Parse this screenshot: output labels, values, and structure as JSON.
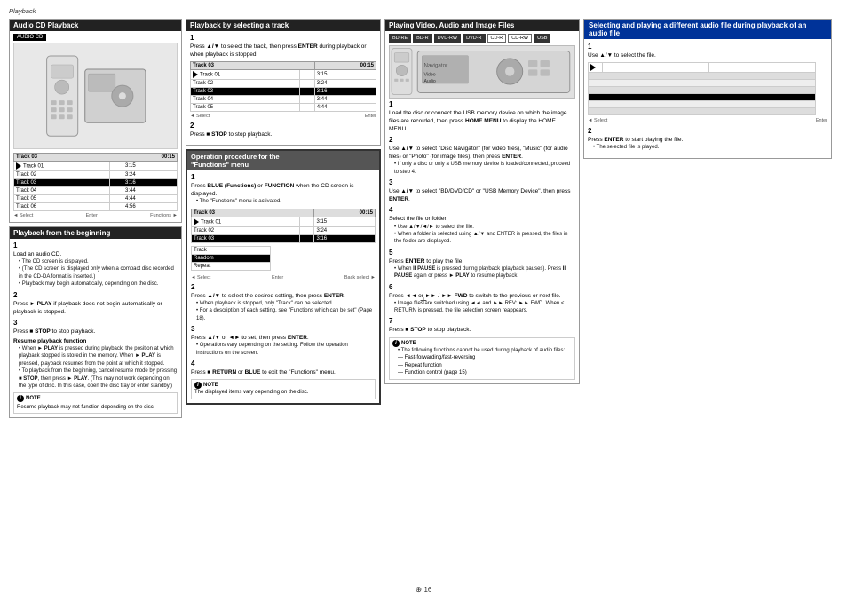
{
  "page": {
    "top_label": "Playback",
    "page_number": "16"
  },
  "section1": {
    "title": "Audio CD Playback",
    "badge": "AUDIO CD",
    "playback_from_beginning": {
      "title": "Playback from the beginning",
      "steps": [
        {
          "num": "1",
          "text": "Load an audio CD.",
          "bullets": [
            "The CD screen is displayed.",
            "(The CD screen is displayed only when a compact disc recorded in the CD-DA format is inserted.)",
            "Playback may begin automatically, depending on the disc."
          ]
        },
        {
          "num": "2",
          "text": "Press ► PLAY if playback does not begin automatically or playback is stopped."
        },
        {
          "num": "3",
          "text": "Press ■ STOP to stop playback."
        }
      ],
      "resume_title": "Resume playback function",
      "resume_bullets": [
        "When ► PLAY is pressed during playback, the position at which playback stopped is stored in the memory. When ► PLAY is pressed, playback resumes from the point at which it stopped.",
        "To playback from the beginning, cancel resume mode by pressing ■ STOP, then press ► PLAY. (This may not work depending on the type of disc. In this case, open the disc tray or enter standby.)"
      ],
      "note": "Resume playback may not function depending on the disc."
    },
    "track_table": {
      "headers": [
        "Track 03",
        "",
        "00:15"
      ],
      "tracks": [
        {
          "name": "Track 01",
          "time": "3:15",
          "selected": false
        },
        {
          "name": "Track 02",
          "time": "3:24",
          "selected": false
        },
        {
          "name": "Track 03",
          "time": "3:16",
          "selected": true
        },
        {
          "name": "Track 04",
          "time": "3:44",
          "selected": false
        },
        {
          "name": "Track 05",
          "time": "4:44",
          "selected": false
        },
        {
          "name": "Track 06",
          "time": "4:56",
          "selected": false
        }
      ],
      "footer": [
        "Select",
        "Enter",
        "Functions"
      ]
    }
  },
  "section2": {
    "title": "Playback by selecting a track",
    "step1": {
      "num": "1",
      "text": "Press ▲/▼ to select the track, then press ENTER during playback or when playback is stopped."
    },
    "step2": {
      "num": "2",
      "text": "Press ■ STOP to stop playback."
    },
    "op_section": {
      "title": "Operation procedure for the \"Functions\" menu",
      "step1": {
        "num": "1",
        "text": "Press BLUE (Functions) or FUNCTION when the CD screen is displayed.",
        "bullet": "The \"Functions\" menu is activated."
      },
      "step2": {
        "num": "2",
        "text": "Press ▲/▼ to select the desired setting, then press ENTER.",
        "bullet": "When playback is stopped, only \"Track\" can be selected.",
        "bullet2": "For a description of each setting, see \"Functions which can be set\" (Page 18)."
      },
      "step3": {
        "num": "3",
        "text": "Press ▲/▼ or ◄► to set, then press ENTER.",
        "bullet": "Operations vary depending on the setting. Follow the operation instructions on the screen."
      },
      "step4": {
        "num": "4",
        "text": "Press ■ RETURN or BLUE to exit the \"Functions\" menu."
      },
      "note": "The displayed items vary depending on the disc."
    },
    "track_table2": {
      "headers": [
        "Track 03",
        "",
        "00:15"
      ],
      "tracks": [
        {
          "name": "Track 01",
          "time": "3:15",
          "selected": false
        },
        {
          "name": "Track 02",
          "time": "3:24",
          "selected": false
        },
        {
          "name": "Track 03",
          "time": "3:16",
          "selected": true
        },
        {
          "name": "Track 04",
          "time": "3:44",
          "selected": false
        },
        {
          "name": "Track 05",
          "time": "4:44",
          "selected": false
        }
      ],
      "table2": {
        "col1": "Track",
        "col2_label": "Random",
        "rows": [
          {
            "item": "Track",
            "val": ""
          },
          {
            "item": "Random",
            "val": ""
          },
          {
            "item": "Repeat",
            "val": ""
          }
        ]
      },
      "footer": [
        "Select",
        "Enter",
        "Back select"
      ]
    }
  },
  "section3": {
    "title": "Playing Video, Audio and Image Files",
    "disc_badges": [
      "BD-RE",
      "BD-R",
      "DVD-RW",
      "DVD-R",
      "CD-R",
      "CD-RW",
      "USB"
    ],
    "steps": [
      {
        "num": "1",
        "text": "Load the disc or connect the USB memory device on which the image files are recorded, then press HOME MENU to display the HOME MENU."
      },
      {
        "num": "2",
        "text": "Use ▲/▼ to select \"Disc Navigator\" (for video files), \"Music\" (for audio files) or \"Photo\" (for image files), then press ENTER.",
        "bullet": "If only a disc or only a USB memory device is loaded/connected, proceed to step 4."
      },
      {
        "num": "3",
        "text": "Use ▲/▼ to select \"BD/DVD/CD\" or \"USB Memory Device\", then press ENTER."
      },
      {
        "num": "4",
        "text": "Select the file or folder.",
        "bullets": [
          "Use ▲/▼/◄/► to select the file.",
          "When a folder is selected using ▲/▼ and ENTER is pressed, the files in the folder are displayed."
        ]
      },
      {
        "num": "5",
        "text": "Press ENTER to play the file.",
        "bullets": [
          "When II PAUSE is pressed during playback (playback pauses). Press II PAUSE again or press ► PLAY to resume playback."
        ]
      },
      {
        "num": "6",
        "text": "Press ◄◄ or ►► / ►► / ►► to switch to the previous or next file.",
        "bullets": [
          "Image files are switched using ◄◄ and ►► REV: ►► FWD. When < RETURN is pressed, the file selection screen reappears."
        ]
      },
      {
        "num": "7",
        "text": "Press ■ STOP to stop playback."
      }
    ],
    "note": {
      "title": "NOTE",
      "bullets": [
        "The following functions cannot be used during playback of audio files:",
        "— Fast-forwarding/fast-reversing",
        "— Repeat function",
        "— Function control (page 15)"
      ]
    }
  },
  "section4": {
    "title": "Selecting and playing a different audio file during playback of an audio file",
    "steps": [
      {
        "num": "1",
        "text": "Use ▲/▼ to select the file."
      },
      {
        "num": "2",
        "text": "Press ENTER to start playing the file.",
        "bullet": "The selected file is played."
      }
    ]
  }
}
